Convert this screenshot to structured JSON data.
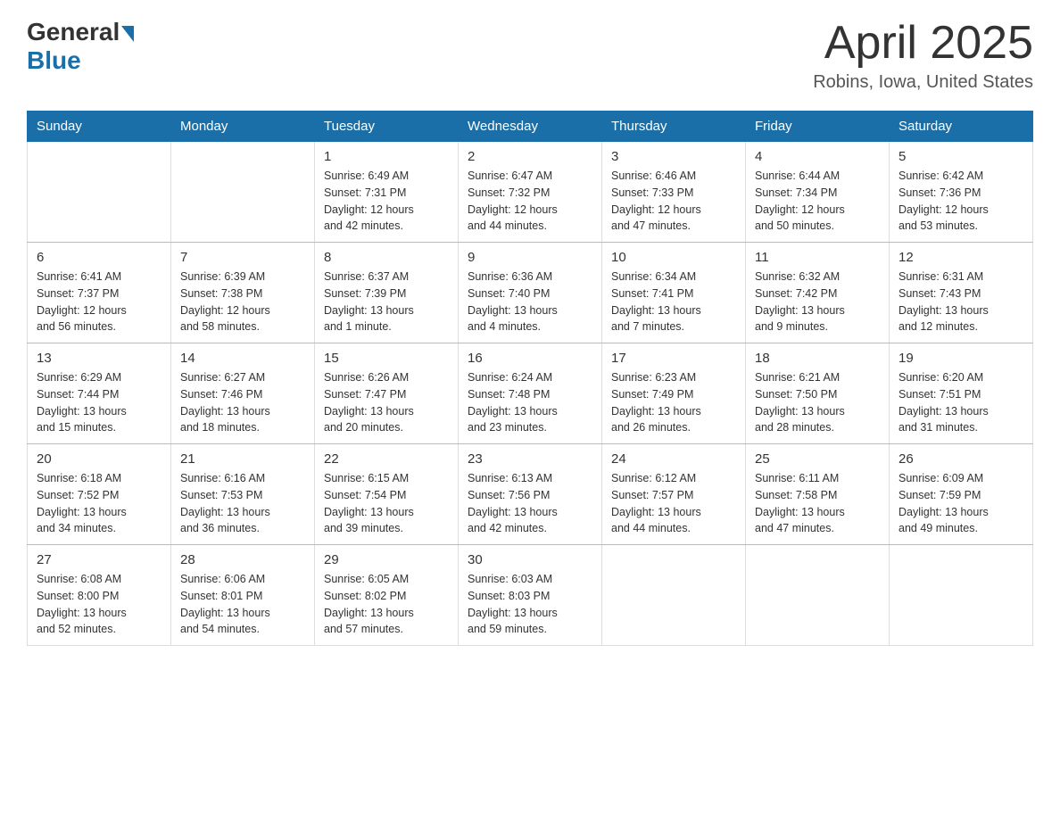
{
  "header": {
    "logo_general": "General",
    "logo_blue": "Blue",
    "month_title": "April 2025",
    "location": "Robins, Iowa, United States"
  },
  "days_of_week": [
    "Sunday",
    "Monday",
    "Tuesday",
    "Wednesday",
    "Thursday",
    "Friday",
    "Saturday"
  ],
  "weeks": [
    [
      {
        "day": "",
        "info": ""
      },
      {
        "day": "",
        "info": ""
      },
      {
        "day": "1",
        "info": "Sunrise: 6:49 AM\nSunset: 7:31 PM\nDaylight: 12 hours\nand 42 minutes."
      },
      {
        "day": "2",
        "info": "Sunrise: 6:47 AM\nSunset: 7:32 PM\nDaylight: 12 hours\nand 44 minutes."
      },
      {
        "day": "3",
        "info": "Sunrise: 6:46 AM\nSunset: 7:33 PM\nDaylight: 12 hours\nand 47 minutes."
      },
      {
        "day": "4",
        "info": "Sunrise: 6:44 AM\nSunset: 7:34 PM\nDaylight: 12 hours\nand 50 minutes."
      },
      {
        "day": "5",
        "info": "Sunrise: 6:42 AM\nSunset: 7:36 PM\nDaylight: 12 hours\nand 53 minutes."
      }
    ],
    [
      {
        "day": "6",
        "info": "Sunrise: 6:41 AM\nSunset: 7:37 PM\nDaylight: 12 hours\nand 56 minutes."
      },
      {
        "day": "7",
        "info": "Sunrise: 6:39 AM\nSunset: 7:38 PM\nDaylight: 12 hours\nand 58 minutes."
      },
      {
        "day": "8",
        "info": "Sunrise: 6:37 AM\nSunset: 7:39 PM\nDaylight: 13 hours\nand 1 minute."
      },
      {
        "day": "9",
        "info": "Sunrise: 6:36 AM\nSunset: 7:40 PM\nDaylight: 13 hours\nand 4 minutes."
      },
      {
        "day": "10",
        "info": "Sunrise: 6:34 AM\nSunset: 7:41 PM\nDaylight: 13 hours\nand 7 minutes."
      },
      {
        "day": "11",
        "info": "Sunrise: 6:32 AM\nSunset: 7:42 PM\nDaylight: 13 hours\nand 9 minutes."
      },
      {
        "day": "12",
        "info": "Sunrise: 6:31 AM\nSunset: 7:43 PM\nDaylight: 13 hours\nand 12 minutes."
      }
    ],
    [
      {
        "day": "13",
        "info": "Sunrise: 6:29 AM\nSunset: 7:44 PM\nDaylight: 13 hours\nand 15 minutes."
      },
      {
        "day": "14",
        "info": "Sunrise: 6:27 AM\nSunset: 7:46 PM\nDaylight: 13 hours\nand 18 minutes."
      },
      {
        "day": "15",
        "info": "Sunrise: 6:26 AM\nSunset: 7:47 PM\nDaylight: 13 hours\nand 20 minutes."
      },
      {
        "day": "16",
        "info": "Sunrise: 6:24 AM\nSunset: 7:48 PM\nDaylight: 13 hours\nand 23 minutes."
      },
      {
        "day": "17",
        "info": "Sunrise: 6:23 AM\nSunset: 7:49 PM\nDaylight: 13 hours\nand 26 minutes."
      },
      {
        "day": "18",
        "info": "Sunrise: 6:21 AM\nSunset: 7:50 PM\nDaylight: 13 hours\nand 28 minutes."
      },
      {
        "day": "19",
        "info": "Sunrise: 6:20 AM\nSunset: 7:51 PM\nDaylight: 13 hours\nand 31 minutes."
      }
    ],
    [
      {
        "day": "20",
        "info": "Sunrise: 6:18 AM\nSunset: 7:52 PM\nDaylight: 13 hours\nand 34 minutes."
      },
      {
        "day": "21",
        "info": "Sunrise: 6:16 AM\nSunset: 7:53 PM\nDaylight: 13 hours\nand 36 minutes."
      },
      {
        "day": "22",
        "info": "Sunrise: 6:15 AM\nSunset: 7:54 PM\nDaylight: 13 hours\nand 39 minutes."
      },
      {
        "day": "23",
        "info": "Sunrise: 6:13 AM\nSunset: 7:56 PM\nDaylight: 13 hours\nand 42 minutes."
      },
      {
        "day": "24",
        "info": "Sunrise: 6:12 AM\nSunset: 7:57 PM\nDaylight: 13 hours\nand 44 minutes."
      },
      {
        "day": "25",
        "info": "Sunrise: 6:11 AM\nSunset: 7:58 PM\nDaylight: 13 hours\nand 47 minutes."
      },
      {
        "day": "26",
        "info": "Sunrise: 6:09 AM\nSunset: 7:59 PM\nDaylight: 13 hours\nand 49 minutes."
      }
    ],
    [
      {
        "day": "27",
        "info": "Sunrise: 6:08 AM\nSunset: 8:00 PM\nDaylight: 13 hours\nand 52 minutes."
      },
      {
        "day": "28",
        "info": "Sunrise: 6:06 AM\nSunset: 8:01 PM\nDaylight: 13 hours\nand 54 minutes."
      },
      {
        "day": "29",
        "info": "Sunrise: 6:05 AM\nSunset: 8:02 PM\nDaylight: 13 hours\nand 57 minutes."
      },
      {
        "day": "30",
        "info": "Sunrise: 6:03 AM\nSunset: 8:03 PM\nDaylight: 13 hours\nand 59 minutes."
      },
      {
        "day": "",
        "info": ""
      },
      {
        "day": "",
        "info": ""
      },
      {
        "day": "",
        "info": ""
      }
    ]
  ]
}
